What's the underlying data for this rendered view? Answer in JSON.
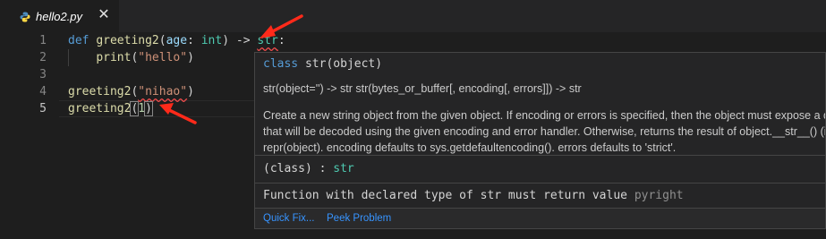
{
  "tab": {
    "filename": "hello2.py",
    "close_glyph": "✕",
    "icon": "python-file-icon"
  },
  "gutter": [
    "1",
    "2",
    "3",
    "4",
    "5"
  ],
  "code": {
    "line1": {
      "kw": "def",
      "name": "greeting2",
      "p1": "(",
      "param": "age",
      "colon": ": ",
      "type": "int",
      "p2": ") -> ",
      "ret": "str",
      "end": ":"
    },
    "line2": {
      "indent": "    ",
      "fn": "print",
      "open": "(",
      "str": "\"hello\"",
      "close": ")"
    },
    "line4": {
      "fn": "greeting2",
      "open": "(",
      "str": "\"nihao\"",
      "close": ")"
    },
    "line5": {
      "fn": "greeting2",
      "open": "(",
      "num": "1",
      "close": ")"
    }
  },
  "hover": {
    "sig_kw": "class",
    "sig_rest": " str(object)",
    "sig2": "str(object='') -> str str(bytes_or_buffer[, encoding[, errors]]) -> str",
    "doc": [
      "Create a new string object from the given object. If encoding or errors is specified, then the object must expose a data buffer",
      "that will be decoded using the given encoding and error handler. Otherwise, returns the result of object.__str__() (if defined) or",
      "repr(object). encoding defaults to sys.getdefaultencoding(). errors defaults to 'strict'."
    ],
    "cls_prefix": "(class) : ",
    "cls_type": "str",
    "error": "Function with declared type of str must return value ",
    "error_source": "pyright",
    "actions": [
      "Quick Fix...",
      "Peek Problem"
    ]
  },
  "colors": {
    "arrow": "#ff2a1a",
    "error_squiggle": "#f14c4c",
    "link": "#3794ff"
  }
}
